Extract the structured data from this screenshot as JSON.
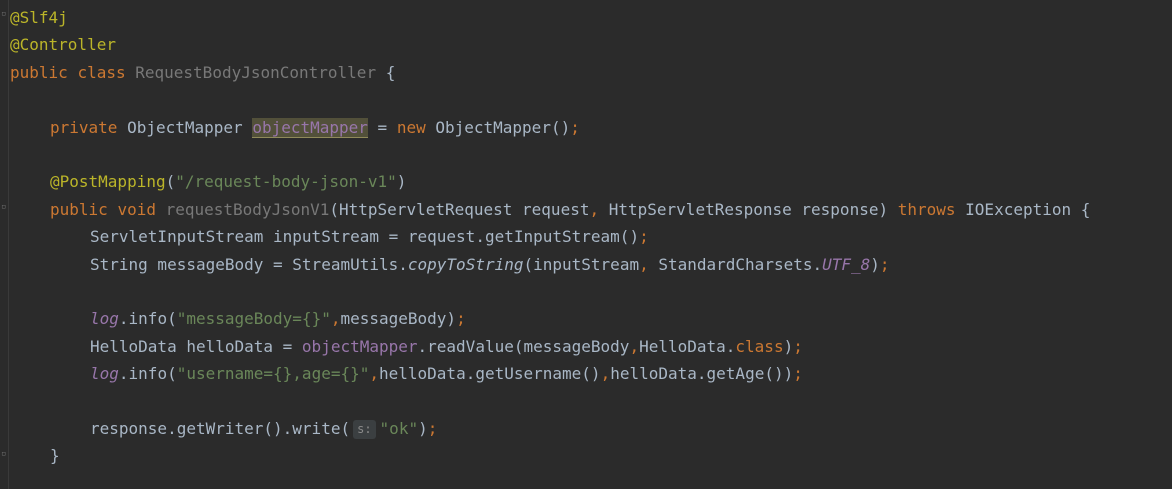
{
  "editor": {
    "language": "Java",
    "theme_colors": {
      "background": "#2b2b2b",
      "keyword": "#cc7832",
      "annotation": "#bbb529",
      "string": "#6a8759",
      "field": "#9876aa",
      "text": "#a9b7c6"
    },
    "lines": {
      "l1": {
        "ann": "@Slf4j"
      },
      "l2": {
        "ann": "@Controller"
      },
      "l3": {
        "kw1": "public",
        "kw2": "class",
        "name": "RequestBodyJsonController",
        "brace": " {"
      },
      "l5": {
        "kw": "private",
        "type": "ObjectMapper",
        "field": "objectMapper",
        "eq": " = ",
        "kw_new": "new",
        "call": " ObjectMapper()",
        "semi": ";"
      },
      "l7": {
        "ann": "@PostMapping",
        "open": "(",
        "str": "\"/request-body-json-v1\"",
        "close": ")"
      },
      "l8": {
        "kw1": "public",
        "kw2": "void",
        "name": "requestBodyJsonV1",
        "params": "(HttpServletRequest request",
        "comma": ",",
        "params2": " HttpServletResponse response) ",
        "kw3": "throws",
        "rest": " IOException {"
      },
      "l9": {
        "text": "ServletInputStream inputStream = request.getInputStream()",
        "semi": ";"
      },
      "l10": {
        "text1": "String messageBody = StreamUtils.",
        "method": "copyToString",
        "text2": "(inputStream",
        "comma": ",",
        "text3": " StandardCharsets.",
        "const": "UTF_8",
        "text4": ")",
        "semi": ";"
      },
      "l12": {
        "log": "log",
        "call": ".info(",
        "str": "\"messageBody={}\"",
        "comma": ",",
        "rest": "messageBody)",
        "semi": ";"
      },
      "l13": {
        "text1": "HelloData helloData = ",
        "field": "objectMapper",
        "text2": ".readValue(messageBody",
        "comma": ",",
        "text3": "HelloData.",
        "kw": "class",
        "text4": ")",
        "semi": ";"
      },
      "l14": {
        "log": "log",
        "call": ".info(",
        "str": "\"username={},age={}\"",
        "comma1": ",",
        "text1": "helloData.getUsername()",
        "comma2": ",",
        "text2": "helloData.getAge())",
        "semi": ";"
      },
      "l16": {
        "text1": "response.getWriter().write(",
        "hint": "s:",
        "str": "\"ok\"",
        "text2": ")",
        "semi": ";"
      },
      "l17": {
        "brace": "}"
      }
    }
  }
}
